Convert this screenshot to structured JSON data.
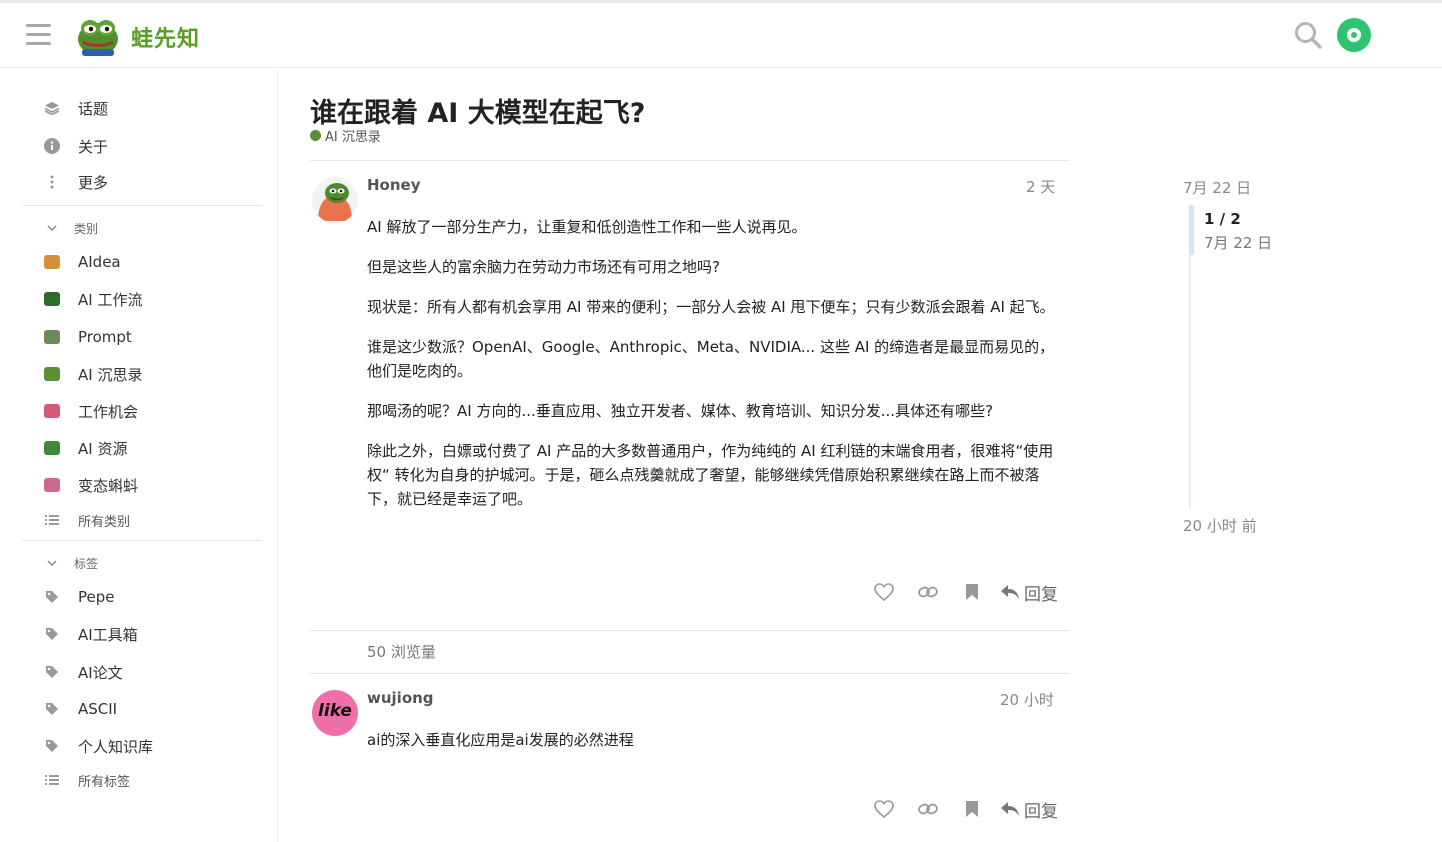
{
  "header": {
    "site_name": "蛙先知",
    "icons": {
      "menu": "hamburger-menu-icon",
      "search": "search-icon",
      "user": "user-avatar-icon"
    },
    "brand_color": "#5a9e23"
  },
  "sidebar": {
    "nav": [
      {
        "label": "话题",
        "icon": "layers-icon"
      },
      {
        "label": "关于",
        "icon": "info-icon"
      },
      {
        "label": "更多",
        "icon": "vertical-ellipsis-icon"
      }
    ],
    "categories_header": "类别",
    "categories": [
      {
        "label": "AIdea",
        "color": "#d4913a"
      },
      {
        "label": "AI 工作流",
        "color": "#2f6b2a"
      },
      {
        "label": "Prompt",
        "color": "#6c8a58"
      },
      {
        "label": "AI 沉思录",
        "color": "#5a8f3a"
      },
      {
        "label": "工作机会",
        "color": "#d25b78"
      },
      {
        "label": "AI 资源",
        "color": "#3e8a3b"
      },
      {
        "label": "变态蝌蚪",
        "color": "#cc6a8d"
      }
    ],
    "all_categories": "所有类别",
    "tags_header": "标签",
    "tags": [
      "Pepe",
      "AI工具箱",
      "AI论文",
      "ASCII",
      "个人知识库"
    ],
    "all_tags": "所有标签"
  },
  "topic": {
    "title": "谁在跟着 AI 大模型在起飞?",
    "category": "AI 沉思录",
    "views": "50 浏览量"
  },
  "posts": [
    {
      "username": "Honey",
      "date": "2 天",
      "paragraphs": [
        "AI 解放了一部分生产力，让重复和低创造性工作和一些人说再见。",
        "但是这些人的富余脑力在劳动力市场还有可用之地吗?",
        "现状是：所有人都有机会享用 AI 带来的便利；一部分人会被 AI 甩下便车；只有少数派会跟着 AI 起飞。",
        "谁是这少数派？OpenAI、Google、Anthropic、Meta、NVIDIA... 这些 AI 的缔造者是最显而易见的，他们是吃肉的。",
        "那喝汤的呢？AI 方向的...垂直应用、独立开发者、媒体、教育培训、知识分发...具体还有哪些?",
        "除此之外，白嫖或付费了 AI 产品的大多数普通用户，作为纯纯的 AI 红利链的末端食用者，很难将“使用权“ 转化为自身的护城河。于是，砸么点残羹就成了奢望，能够继续凭借原始积累继续在路上而不被落下，就已经是幸运了吧。"
      ],
      "reply_label": "回复"
    },
    {
      "username": "wujiong",
      "date": "20 小时",
      "paragraphs": [
        "ai的深入垂直化应用是ai发展的必然进程"
      ],
      "avatar_text": "like",
      "reply_label": "回复"
    }
  ],
  "timeline": {
    "start": "7月 22 日",
    "position": "1 / 2",
    "position_date": "7月 22 日",
    "end": "20 小时 前"
  },
  "action_icons": [
    "like-heart-icon",
    "copy-link-icon",
    "bookmark-icon",
    "reply-arrow-icon"
  ]
}
